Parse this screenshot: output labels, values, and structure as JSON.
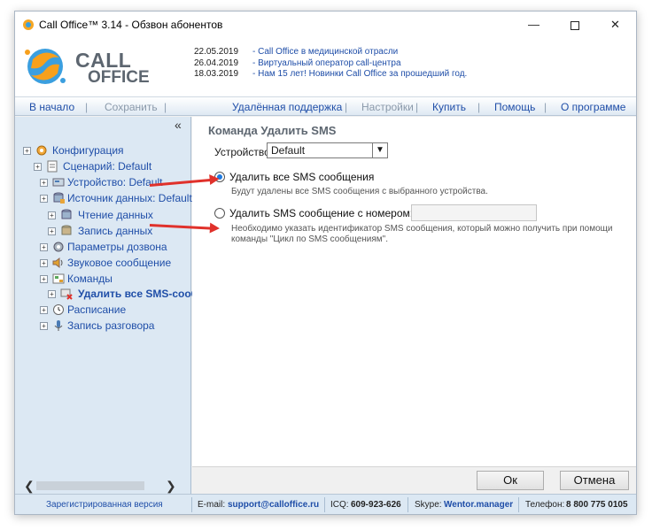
{
  "window": {
    "title": "Call Office™ 3.14 - Обзвон абонентов",
    "minimize": "—",
    "close": "✕"
  },
  "logo": {
    "line1": "CALL",
    "line2": "OFFICE"
  },
  "news": [
    {
      "date": "22.05.2019",
      "text": "- Call Office в медицинской отрасли"
    },
    {
      "date": "26.04.2019",
      "text": "- Виртуальный оператор call-центра"
    },
    {
      "date": "18.03.2019",
      "text": "- Нам 15 лет! Новинки Call Office за прошедший год."
    }
  ],
  "menu": {
    "home": "В начало",
    "save": "Сохранить",
    "remote": "Удалённая поддержка",
    "settings": "Настройки",
    "buy": "Купить",
    "help": "Помощь",
    "about": "О программе",
    "sep": "|"
  },
  "sidebar": {
    "collapse": "«",
    "tree": [
      {
        "label": "Конфигурация",
        "icon": "gear-icon"
      },
      {
        "label": "Сценарий: Default",
        "icon": "document-icon"
      },
      {
        "label": "Устройство: Default",
        "icon": "device-icon"
      },
      {
        "label": "Источник данных: Default",
        "icon": "database-icon"
      },
      {
        "label": "Чтение данных",
        "icon": "database-read-icon"
      },
      {
        "label": "Запись данных",
        "icon": "database-write-icon"
      },
      {
        "label": "Параметры дозвона",
        "icon": "gear-icon"
      },
      {
        "label": "Звуковое сообщение",
        "icon": "speaker-icon"
      },
      {
        "label": "Команды",
        "icon": "commands-icon"
      },
      {
        "label": "Удалить все SMS-сооб",
        "icon": "delete-sms-icon"
      },
      {
        "label": "Расписание",
        "icon": "clock-icon"
      },
      {
        "label": "Запись разговора",
        "icon": "microphone-icon"
      }
    ],
    "scroll_left": "❮",
    "scroll_right": "❯",
    "expander": "+"
  },
  "content": {
    "title": "Команда Удалить SMS",
    "device_label": "Устройство:",
    "device_value": "Default",
    "dropdown_arrow": "▼",
    "option1_label": "Удалить все SMS сообщения",
    "option1_hint": "Будут удалены все SMS сообщения с выбранного устройства.",
    "option2_label": "Удалить SMS сообщение с номером:",
    "option2_value": "",
    "option2_hint": "Необходимо указать идентификатор SMS сообщения, который можно получить при помощи команды \"Цикл по SMS сообщениям\"."
  },
  "buttons": {
    "ok": "Ок",
    "cancel": "Отмена"
  },
  "status": {
    "registered": "Зарегистрированная версия",
    "email_label": "E-mail:",
    "email": "support@calloffice.ru",
    "icq_label": "ICQ:",
    "icq": "609-923-626",
    "skype_label": "Skype:",
    "skype": "Wentor.manager",
    "phone_label": "Телефон:",
    "phone": "8 800 775 0105"
  },
  "colors": {
    "accent": "#1f4ea8",
    "panel": "#dce8f3",
    "arrow": "#e0312b"
  }
}
